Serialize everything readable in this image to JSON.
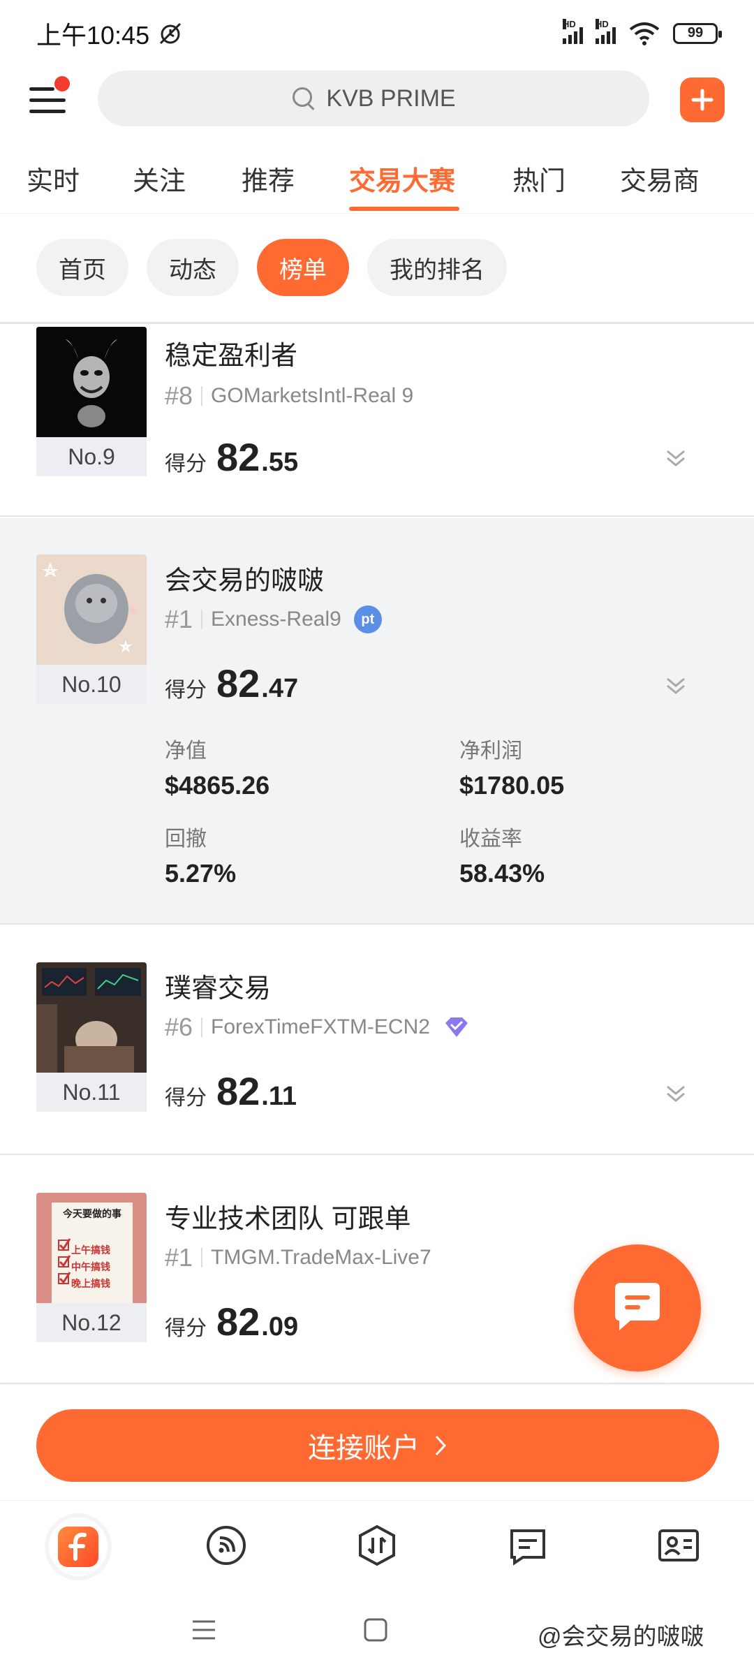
{
  "status_bar": {
    "time": "上午10:45",
    "battery": "99",
    "signal_label": "HD"
  },
  "header": {
    "search_placeholder": "KVB PRIME"
  },
  "tabs": [
    {
      "label": "实时"
    },
    {
      "label": "关注"
    },
    {
      "label": "推荐"
    },
    {
      "label": "交易大赛"
    },
    {
      "label": "热门"
    },
    {
      "label": "交易商"
    }
  ],
  "subtabs": [
    {
      "label": "首页"
    },
    {
      "label": "动态"
    },
    {
      "label": "榜单"
    },
    {
      "label": "我的排名"
    }
  ],
  "score_label": "得分",
  "ranking": [
    {
      "rank": "No.9",
      "name": "稳定盈利者",
      "hash": "#8",
      "account": "GOMarketsIntl-Real 9",
      "score_int": "82",
      "score_dec": ".55"
    },
    {
      "rank": "No.10",
      "name": "会交易的啵啵",
      "hash": "#1",
      "account": "Exness-Real9",
      "score_int": "82",
      "score_dec": ".47",
      "badge": "pt",
      "stats": {
        "equity_label": "净值",
        "equity": "$4865.26",
        "profit_label": "净利润",
        "profit": "$1780.05",
        "drawdown_label": "回撤",
        "drawdown": "5.27%",
        "return_label": "收益率",
        "return": "58.43%"
      }
    },
    {
      "rank": "No.11",
      "name": "璞睿交易",
      "hash": "#6",
      "account": "ForexTimeFXTM-ECN2",
      "score_int": "82",
      "score_dec": ".11"
    },
    {
      "rank": "No.12",
      "name": "专业技术团队 可跟单",
      "hash": "#1",
      "account": "TMGM.TradeMax-Live7",
      "score_int": "82",
      "score_dec": ".09",
      "thumb_title": "今天要做的事",
      "thumb_items": [
        "上午搞钱",
        "中午搞钱",
        "晚上搞钱"
      ]
    }
  ],
  "connect_button": "连接账户",
  "watermark": "@会交易的啵啵",
  "colors": {
    "accent": "#ff6a33",
    "highlight_bg": "#f2f3f5"
  },
  "icons": [
    "search-icon",
    "plus-icon",
    "menu-icon",
    "chevron-down-icon",
    "chat-icon",
    "home-icon",
    "feed-icon",
    "trade-icon",
    "message-icon",
    "profile-icon"
  ]
}
